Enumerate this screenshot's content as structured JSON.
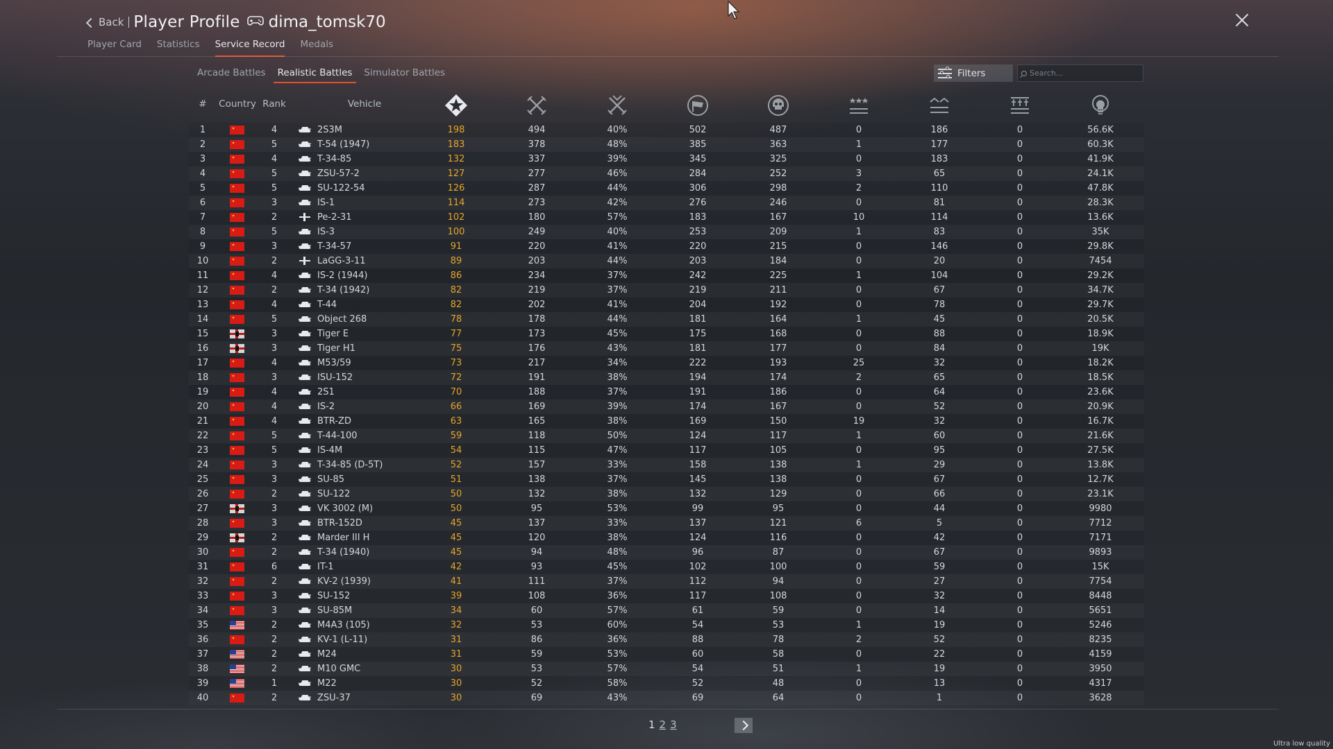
{
  "header": {
    "back_label": "Back",
    "title": "Player Profile",
    "username": "dima_tomsk70"
  },
  "main_tabs": [
    "Player Card",
    "Statistics",
    "Service Record",
    "Medals"
  ],
  "main_tab_active": "Service Record",
  "mode_tabs": [
    "Arcade Battles",
    "Realistic Battles",
    "Simulator Battles"
  ],
  "mode_tab_active": "Realistic Battles",
  "filters_label": "Filters",
  "search": {
    "placeholder": "Search...",
    "value": ""
  },
  "columns": {
    "num": "#",
    "country": "Country",
    "rank": "Rank",
    "vehicle": "Vehicle",
    "icon_columns": [
      "battles-icon",
      "kills-icon",
      "winrate-icon",
      "respawns-icon",
      "deaths-icon",
      "air-kills-icon",
      "ground-kills-icon",
      "naval-kills-icon",
      "research-points-icon"
    ]
  },
  "rows": [
    {
      "n": "1",
      "country": "cn",
      "rank": "4",
      "type": "tank",
      "vehicle": "2S3M",
      "battles": "198",
      "c2": "494",
      "c3": "40%",
      "c4": "502",
      "c5": "487",
      "c6": "0",
      "c7": "186",
      "c8": "0",
      "c9": "56.6K"
    },
    {
      "n": "2",
      "country": "cn",
      "rank": "5",
      "type": "tank",
      "vehicle": "T-54 (1947)",
      "battles": "183",
      "c2": "378",
      "c3": "48%",
      "c4": "385",
      "c5": "363",
      "c6": "1",
      "c7": "177",
      "c8": "0",
      "c9": "60.3K"
    },
    {
      "n": "3",
      "country": "cn",
      "rank": "4",
      "type": "tank",
      "vehicle": "T-34-85",
      "battles": "132",
      "c2": "337",
      "c3": "39%",
      "c4": "345",
      "c5": "325",
      "c6": "0",
      "c7": "183",
      "c8": "0",
      "c9": "41.9K"
    },
    {
      "n": "4",
      "country": "cn",
      "rank": "5",
      "type": "tank",
      "vehicle": "ZSU-57-2",
      "battles": "127",
      "c2": "277",
      "c3": "46%",
      "c4": "284",
      "c5": "252",
      "c6": "3",
      "c7": "65",
      "c8": "0",
      "c9": "24.1K"
    },
    {
      "n": "5",
      "country": "cn",
      "rank": "5",
      "type": "tank",
      "vehicle": "SU-122-54",
      "battles": "126",
      "c2": "287",
      "c3": "44%",
      "c4": "306",
      "c5": "298",
      "c6": "2",
      "c7": "110",
      "c8": "0",
      "c9": "47.8K"
    },
    {
      "n": "6",
      "country": "cn",
      "rank": "3",
      "type": "tank",
      "vehicle": "IS-1",
      "battles": "114",
      "c2": "273",
      "c3": "42%",
      "c4": "276",
      "c5": "246",
      "c6": "0",
      "c7": "81",
      "c8": "0",
      "c9": "28.3K"
    },
    {
      "n": "7",
      "country": "cn",
      "rank": "2",
      "type": "plane",
      "vehicle": "Pe-2-31",
      "battles": "102",
      "c2": "180",
      "c3": "57%",
      "c4": "183",
      "c5": "167",
      "c6": "10",
      "c7": "114",
      "c8": "0",
      "c9": "13.6K"
    },
    {
      "n": "8",
      "country": "cn",
      "rank": "5",
      "type": "tank",
      "vehicle": "IS-3",
      "battles": "100",
      "c2": "249",
      "c3": "40%",
      "c4": "253",
      "c5": "209",
      "c6": "1",
      "c7": "83",
      "c8": "0",
      "c9": "35K"
    },
    {
      "n": "9",
      "country": "cn",
      "rank": "3",
      "type": "tank",
      "vehicle": "T-34-57",
      "battles": "91",
      "c2": "220",
      "c3": "41%",
      "c4": "220",
      "c5": "215",
      "c6": "0",
      "c7": "146",
      "c8": "0",
      "c9": "29.8K"
    },
    {
      "n": "10",
      "country": "cn",
      "rank": "2",
      "type": "plane",
      "vehicle": "LaGG-3-11",
      "battles": "89",
      "c2": "203",
      "c3": "44%",
      "c4": "203",
      "c5": "184",
      "c6": "0",
      "c7": "20",
      "c8": "0",
      "c9": "7454"
    },
    {
      "n": "11",
      "country": "cn",
      "rank": "4",
      "type": "tank",
      "vehicle": "IS-2 (1944)",
      "battles": "86",
      "c2": "234",
      "c3": "37%",
      "c4": "242",
      "c5": "225",
      "c6": "1",
      "c7": "104",
      "c8": "0",
      "c9": "29.2K"
    },
    {
      "n": "12",
      "country": "cn",
      "rank": "2",
      "type": "tank",
      "vehicle": "T-34 (1942)",
      "battles": "82",
      "c2": "219",
      "c3": "37%",
      "c4": "219",
      "c5": "211",
      "c6": "0",
      "c7": "67",
      "c8": "0",
      "c9": "34.7K"
    },
    {
      "n": "13",
      "country": "cn",
      "rank": "4",
      "type": "tank",
      "vehicle": "T-44",
      "battles": "82",
      "c2": "202",
      "c3": "41%",
      "c4": "204",
      "c5": "192",
      "c6": "0",
      "c7": "78",
      "c8": "0",
      "c9": "29.7K"
    },
    {
      "n": "14",
      "country": "cn",
      "rank": "5",
      "type": "tank",
      "vehicle": "Object 268",
      "battles": "78",
      "c2": "178",
      "c3": "44%",
      "c4": "181",
      "c5": "164",
      "c6": "1",
      "c7": "45",
      "c8": "0",
      "c9": "20.5K"
    },
    {
      "n": "15",
      "country": "de",
      "rank": "3",
      "type": "tank",
      "vehicle": "Tiger E",
      "battles": "77",
      "c2": "173",
      "c3": "45%",
      "c4": "175",
      "c5": "168",
      "c6": "0",
      "c7": "88",
      "c8": "0",
      "c9": "18.9K"
    },
    {
      "n": "16",
      "country": "de",
      "rank": "3",
      "type": "tank",
      "vehicle": "Tiger H1",
      "battles": "75",
      "c2": "176",
      "c3": "43%",
      "c4": "181",
      "c5": "177",
      "c6": "0",
      "c7": "84",
      "c8": "0",
      "c9": "19K"
    },
    {
      "n": "17",
      "country": "cn",
      "rank": "4",
      "type": "tank",
      "vehicle": "M53/59",
      "battles": "73",
      "c2": "217",
      "c3": "34%",
      "c4": "222",
      "c5": "193",
      "c6": "25",
      "c7": "32",
      "c8": "0",
      "c9": "18.2K"
    },
    {
      "n": "18",
      "country": "cn",
      "rank": "3",
      "type": "tank",
      "vehicle": "ISU-152",
      "battles": "72",
      "c2": "191",
      "c3": "38%",
      "c4": "194",
      "c5": "174",
      "c6": "2",
      "c7": "65",
      "c8": "0",
      "c9": "18.5K"
    },
    {
      "n": "19",
      "country": "cn",
      "rank": "4",
      "type": "tank",
      "vehicle": "2S1",
      "battles": "70",
      "c2": "188",
      "c3": "37%",
      "c4": "191",
      "c5": "186",
      "c6": "0",
      "c7": "64",
      "c8": "0",
      "c9": "23.6K"
    },
    {
      "n": "20",
      "country": "cn",
      "rank": "4",
      "type": "tank",
      "vehicle": "IS-2",
      "battles": "66",
      "c2": "169",
      "c3": "39%",
      "c4": "174",
      "c5": "167",
      "c6": "0",
      "c7": "52",
      "c8": "0",
      "c9": "20.9K"
    },
    {
      "n": "21",
      "country": "cn",
      "rank": "4",
      "type": "tank",
      "vehicle": "BTR-ZD",
      "battles": "63",
      "c2": "165",
      "c3": "38%",
      "c4": "169",
      "c5": "150",
      "c6": "19",
      "c7": "32",
      "c8": "0",
      "c9": "16.7K"
    },
    {
      "n": "22",
      "country": "cn",
      "rank": "5",
      "type": "tank",
      "vehicle": "T-44-100",
      "battles": "59",
      "c2": "118",
      "c3": "50%",
      "c4": "124",
      "c5": "117",
      "c6": "1",
      "c7": "60",
      "c8": "0",
      "c9": "21.6K"
    },
    {
      "n": "23",
      "country": "cn",
      "rank": "5",
      "type": "tank",
      "vehicle": "IS-4M",
      "battles": "54",
      "c2": "115",
      "c3": "47%",
      "c4": "117",
      "c5": "105",
      "c6": "0",
      "c7": "95",
      "c8": "0",
      "c9": "27.5K"
    },
    {
      "n": "24",
      "country": "cn",
      "rank": "3",
      "type": "tank",
      "vehicle": "T-34-85 (D-5T)",
      "battles": "52",
      "c2": "157",
      "c3": "33%",
      "c4": "158",
      "c5": "138",
      "c6": "1",
      "c7": "29",
      "c8": "0",
      "c9": "13.8K"
    },
    {
      "n": "25",
      "country": "cn",
      "rank": "3",
      "type": "tank",
      "vehicle": "SU-85",
      "battles": "51",
      "c2": "138",
      "c3": "37%",
      "c4": "145",
      "c5": "138",
      "c6": "0",
      "c7": "67",
      "c8": "0",
      "c9": "12.7K"
    },
    {
      "n": "26",
      "country": "cn",
      "rank": "2",
      "type": "tank",
      "vehicle": "SU-122",
      "battles": "50",
      "c2": "132",
      "c3": "38%",
      "c4": "132",
      "c5": "129",
      "c6": "0",
      "c7": "66",
      "c8": "0",
      "c9": "23.1K"
    },
    {
      "n": "27",
      "country": "de",
      "rank": "3",
      "type": "tank",
      "vehicle": "VK 3002 (M)",
      "battles": "50",
      "c2": "95",
      "c3": "53%",
      "c4": "99",
      "c5": "95",
      "c6": "0",
      "c7": "44",
      "c8": "0",
      "c9": "9980"
    },
    {
      "n": "28",
      "country": "cn",
      "rank": "3",
      "type": "tank",
      "vehicle": "BTR-152D",
      "battles": "45",
      "c2": "137",
      "c3": "33%",
      "c4": "137",
      "c5": "121",
      "c6": "6",
      "c7": "5",
      "c8": "0",
      "c9": "7712"
    },
    {
      "n": "29",
      "country": "de",
      "rank": "2",
      "type": "tank",
      "vehicle": "Marder III H",
      "battles": "45",
      "c2": "120",
      "c3": "38%",
      "c4": "124",
      "c5": "116",
      "c6": "0",
      "c7": "42",
      "c8": "0",
      "c9": "7171"
    },
    {
      "n": "30",
      "country": "cn",
      "rank": "2",
      "type": "tank",
      "vehicle": "T-34 (1940)",
      "battles": "45",
      "c2": "94",
      "c3": "48%",
      "c4": "96",
      "c5": "87",
      "c6": "0",
      "c7": "67",
      "c8": "0",
      "c9": "9893"
    },
    {
      "n": "31",
      "country": "cn",
      "rank": "6",
      "type": "tank",
      "vehicle": "IT-1",
      "battles": "42",
      "c2": "93",
      "c3": "45%",
      "c4": "102",
      "c5": "100",
      "c6": "0",
      "c7": "59",
      "c8": "0",
      "c9": "15K"
    },
    {
      "n": "32",
      "country": "cn",
      "rank": "2",
      "type": "tank",
      "vehicle": "KV-2 (1939)",
      "battles": "41",
      "c2": "111",
      "c3": "37%",
      "c4": "112",
      "c5": "94",
      "c6": "0",
      "c7": "27",
      "c8": "0",
      "c9": "7754"
    },
    {
      "n": "33",
      "country": "cn",
      "rank": "3",
      "type": "tank",
      "vehicle": "SU-152",
      "battles": "39",
      "c2": "108",
      "c3": "36%",
      "c4": "117",
      "c5": "108",
      "c6": "0",
      "c7": "32",
      "c8": "0",
      "c9": "8448"
    },
    {
      "n": "34",
      "country": "cn",
      "rank": "3",
      "type": "tank",
      "vehicle": "SU-85M",
      "battles": "34",
      "c2": "60",
      "c3": "57%",
      "c4": "61",
      "c5": "59",
      "c6": "0",
      "c7": "14",
      "c8": "0",
      "c9": "5651"
    },
    {
      "n": "35",
      "country": "us",
      "rank": "2",
      "type": "tank",
      "vehicle": "M4A3 (105)",
      "battles": "32",
      "c2": "53",
      "c3": "60%",
      "c4": "54",
      "c5": "53",
      "c6": "1",
      "c7": "19",
      "c8": "0",
      "c9": "5246"
    },
    {
      "n": "36",
      "country": "cn",
      "rank": "2",
      "type": "tank",
      "vehicle": "KV-1 (L-11)",
      "battles": "31",
      "c2": "86",
      "c3": "36%",
      "c4": "88",
      "c5": "78",
      "c6": "2",
      "c7": "52",
      "c8": "0",
      "c9": "8235"
    },
    {
      "n": "37",
      "country": "us",
      "rank": "2",
      "type": "tank",
      "vehicle": "M24",
      "battles": "31",
      "c2": "59",
      "c3": "53%",
      "c4": "60",
      "c5": "58",
      "c6": "0",
      "c7": "22",
      "c8": "0",
      "c9": "4159"
    },
    {
      "n": "38",
      "country": "us",
      "rank": "2",
      "type": "tank",
      "vehicle": "M10 GMC",
      "battles": "30",
      "c2": "53",
      "c3": "57%",
      "c4": "54",
      "c5": "51",
      "c6": "1",
      "c7": "19",
      "c8": "0",
      "c9": "3950"
    },
    {
      "n": "39",
      "country": "us",
      "rank": "1",
      "type": "tank",
      "vehicle": "M22",
      "battles": "30",
      "c2": "52",
      "c3": "58%",
      "c4": "52",
      "c5": "48",
      "c6": "0",
      "c7": "13",
      "c8": "0",
      "c9": "4317"
    },
    {
      "n": "40",
      "country": "cn",
      "rank": "2",
      "type": "tank",
      "vehicle": "ZSU-37",
      "battles": "30",
      "c2": "69",
      "c3": "43%",
      "c4": "69",
      "c5": "64",
      "c6": "0",
      "c7": "1",
      "c8": "0",
      "c9": "3628"
    }
  ],
  "pagination": {
    "pages": [
      "1",
      "2",
      "3"
    ],
    "current": "1"
  },
  "quality_label": "Ultra low quality",
  "colors": {
    "accent": "#e4502e",
    "battles_value": "#e7a52a"
  }
}
